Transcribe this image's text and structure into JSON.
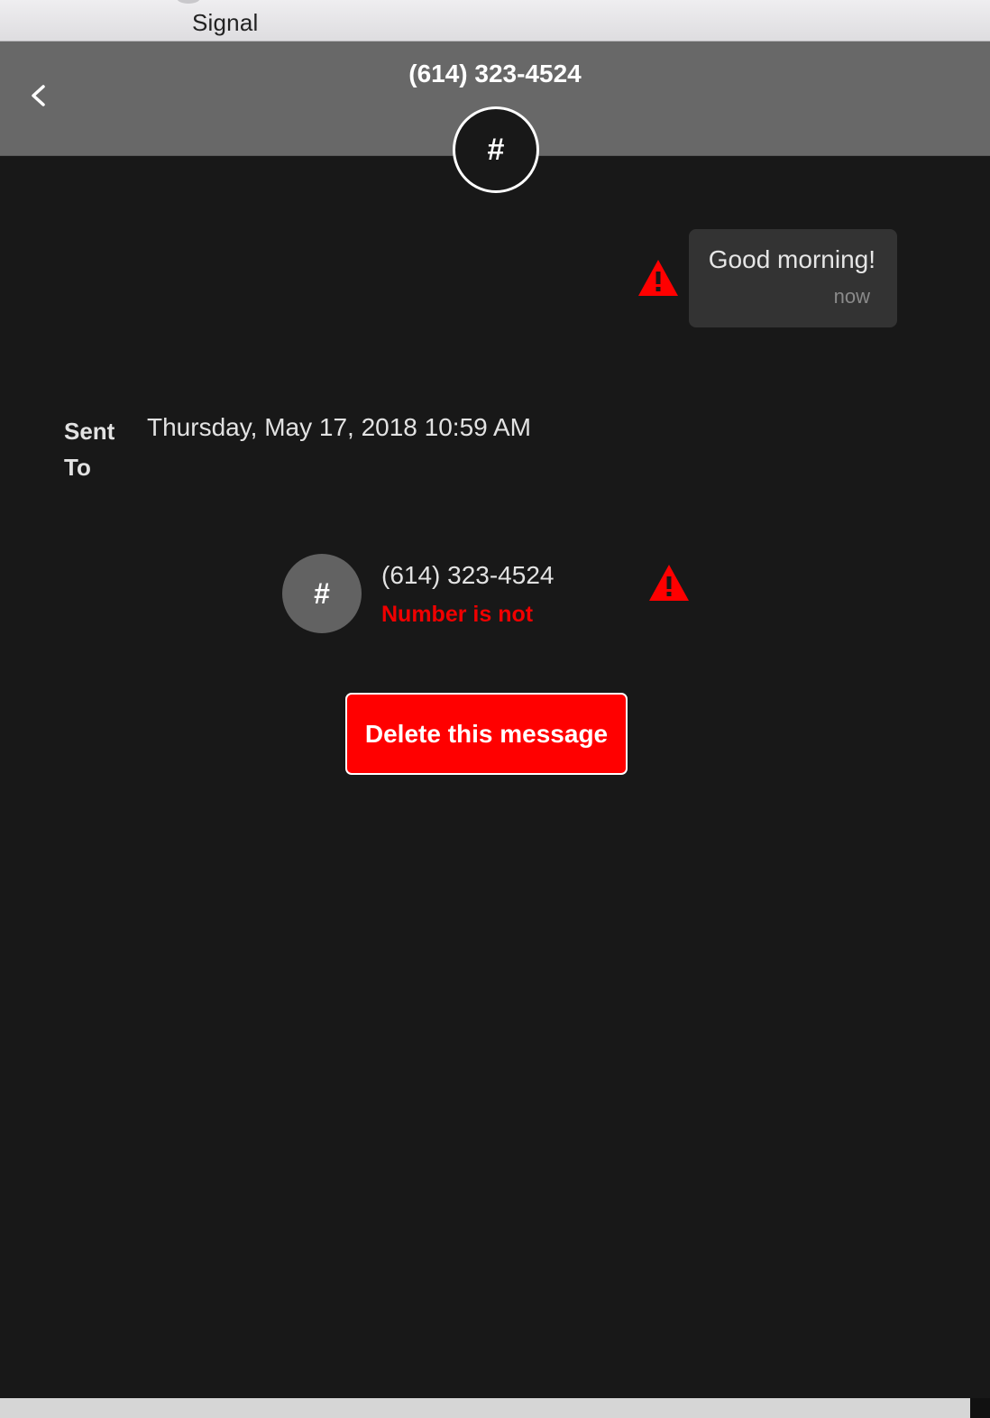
{
  "window": {
    "title": "Signal"
  },
  "header": {
    "title": "(614) 323-4524",
    "avatar_initial": "#"
  },
  "message": {
    "text": "Good morning!",
    "time": "now",
    "status": "error"
  },
  "details": {
    "sent_label": "Sent",
    "to_label": "To",
    "sent_value": "Thursday, May 17, 2018 10:59 AM"
  },
  "recipient": {
    "avatar_initial": "#",
    "number": "(614) 323-4524",
    "error": "Number is not"
  },
  "actions": {
    "delete_label": "Delete this message"
  },
  "icons": {
    "back": "chevron-left-icon",
    "warning": "warning-icon"
  },
  "colors": {
    "background": "#181818",
    "header": "#686868",
    "bubble": "#333333",
    "error": "#ff0000"
  }
}
